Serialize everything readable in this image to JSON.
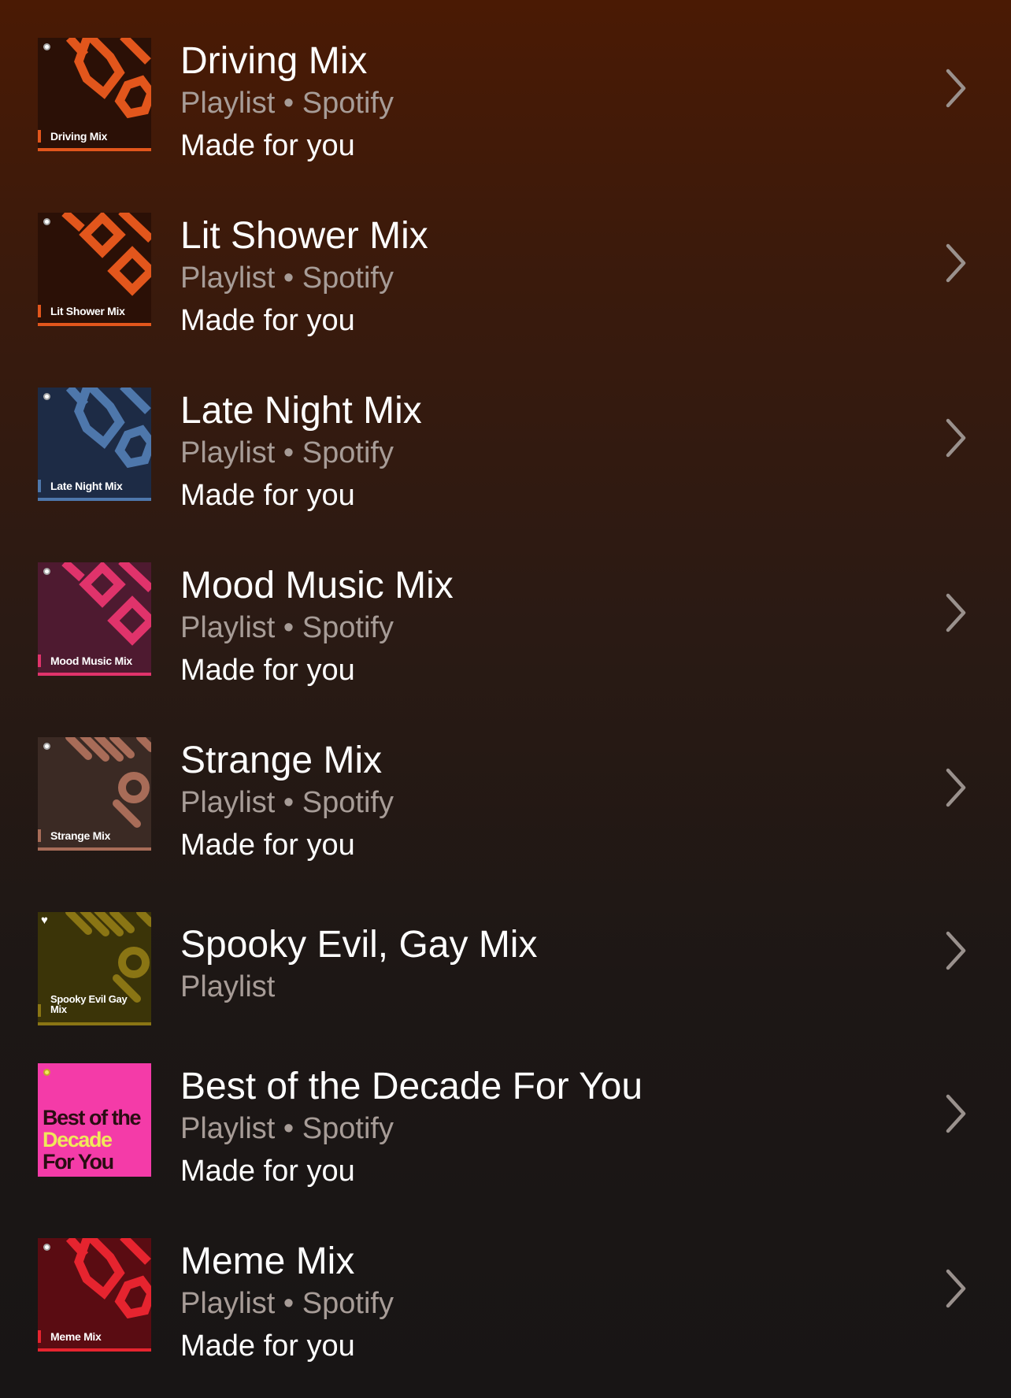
{
  "playlists": [
    {
      "title": "Driving Mix",
      "subtitle": "Playlist • Spotify",
      "made_for": "Made for you",
      "cover_label": "Driving Mix",
      "cover": {
        "bg": "#f4f1ee",
        "accent": "#e2561c",
        "style": "octagon",
        "badge": "dot"
      }
    },
    {
      "title": "Lit Shower Mix",
      "subtitle": "Playlist • Spotify",
      "made_for": "Made for you",
      "cover_label": "Lit Shower Mix",
      "cover": {
        "bg": "#f4f1ee",
        "accent": "#e2561c",
        "style": "diamond",
        "badge": "dot"
      }
    },
    {
      "title": "Late Night Mix",
      "subtitle": "Playlist • Spotify",
      "made_for": "Made for you",
      "cover_label": "Late Night Mix",
      "cover": {
        "bg": "#1d2b45",
        "accent": "#4e77ab",
        "style": "octagon",
        "badge": "dot"
      }
    },
    {
      "title": "Mood Music Mix",
      "subtitle": "Playlist • Spotify",
      "made_for": "Made for you",
      "cover_label": "Mood Music Mix",
      "cover": {
        "bg": "#4e1a30",
        "accent": "#e0336b",
        "style": "diamond",
        "badge": "dot"
      }
    },
    {
      "title": "Strange Mix",
      "subtitle": "Playlist • Spotify",
      "made_for": "Made for you",
      "cover_label": "Strange Mix",
      "cover": {
        "bg": "#3b2a24",
        "accent": "#a86c58",
        "style": "stripes",
        "badge": "dot"
      }
    },
    {
      "title": "Spooky Evil, Gay Mix",
      "subtitle": "Playlist",
      "made_for": "",
      "cover_label": "Spooky Evil Gay Mix",
      "cover": {
        "bg": "#3b3408",
        "accent": "#8a7514",
        "style": "stripes",
        "badge": "heart"
      }
    },
    {
      "title": "Best of the Decade For You",
      "subtitle": "Playlist • Spotify",
      "made_for": "Made for you",
      "cover_label": "",
      "cover": {
        "bg": "#f43ba8",
        "accent": "#f43ba8",
        "style": "decade",
        "badge": "dot"
      },
      "cover_text": [
        "Best of the",
        "Decade",
        "For You"
      ]
    },
    {
      "title": "Meme Mix",
      "subtitle": "Playlist • Spotify",
      "made_for": "Made for you",
      "cover_label": "Meme Mix",
      "cover": {
        "bg": "#5a0c12",
        "accent": "#e6242f",
        "style": "octagon",
        "badge": "dot"
      }
    }
  ],
  "icons": {
    "row_action": "chevron-right-icon"
  }
}
